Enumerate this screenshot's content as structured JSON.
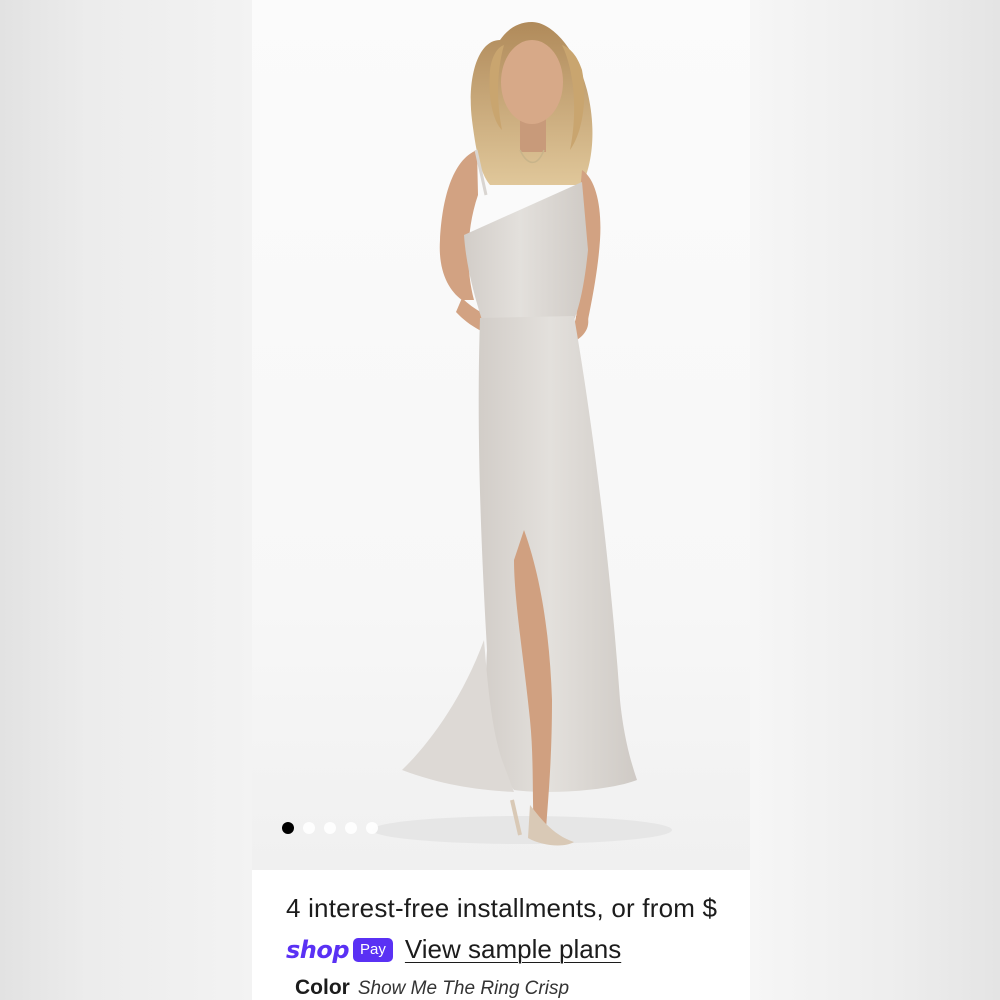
{
  "product": {
    "image_alt": "Model wearing a one-shoulder maxi dress with side slit in light grey",
    "gallery": {
      "slide_count": 5,
      "active_slide": 1
    },
    "dress_color": "#dcd8d4"
  },
  "payment": {
    "installments_text": "4 interest-free installments, or from $",
    "shop_word": "shop",
    "pay_badge": "Pay",
    "link_text": "View sample plans",
    "brand_color": "#5a31f4"
  },
  "color_selector": {
    "label": "Color",
    "value": "Show Me The Ring Crisp"
  }
}
